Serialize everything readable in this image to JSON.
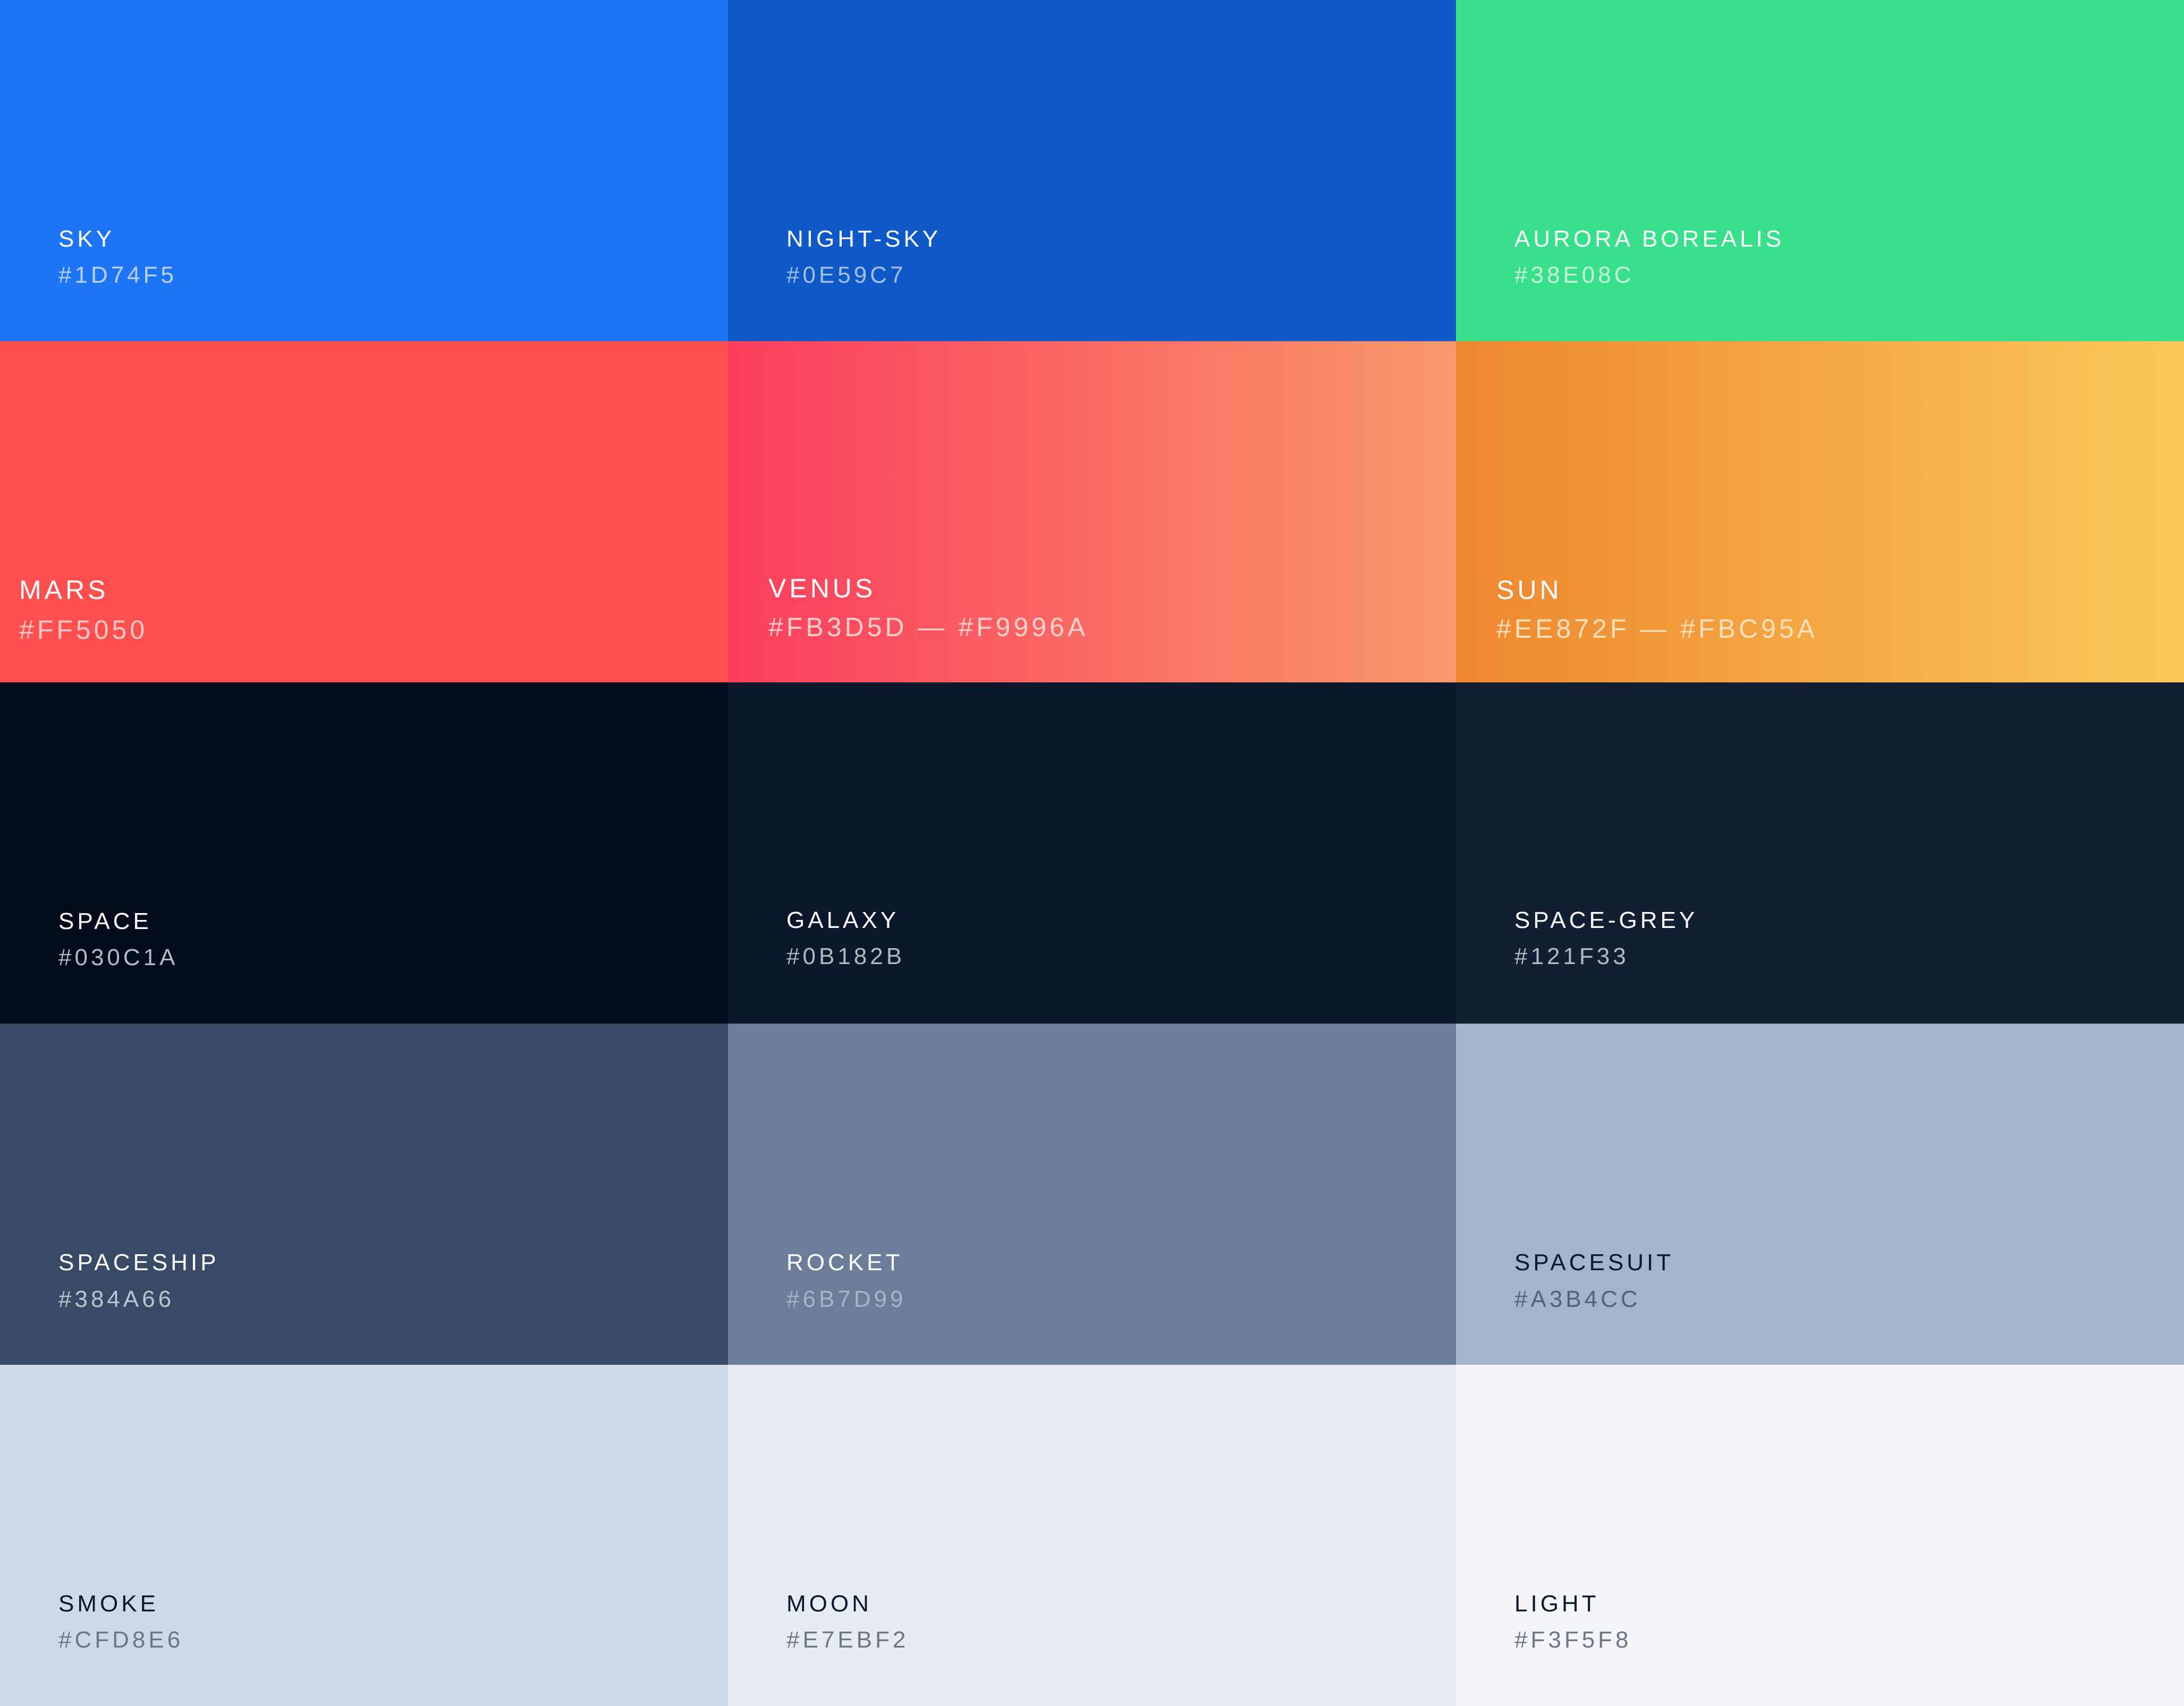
{
  "swatches": [
    {
      "id": "sky",
      "name": "SKY",
      "hex_label": "#1D74F5",
      "colors": [
        "#1D74F5"
      ],
      "name_color": "#ffffff",
      "hex_color": "#B9D2FB"
    },
    {
      "id": "night-sky",
      "name": "NIGHT-SKY",
      "hex_label": "#0E59C7",
      "colors": [
        "#0E59C7"
      ],
      "name_color": "#ffffff",
      "hex_color": "#A6BFE7"
    },
    {
      "id": "aurora-borealis",
      "name": "AURORA BOREALIS",
      "hex_label": "#38E08C",
      "colors": [
        "#38E08C"
      ],
      "name_color": "#ffffff",
      "hex_color": "#C6F5DC"
    },
    {
      "id": "mars",
      "name": "MARS",
      "hex_label": "#FF5050",
      "colors": [
        "#FF5050"
      ],
      "name_color": "#ffffff",
      "hex_color": "#FFC6C6"
    },
    {
      "id": "venus",
      "name": "VENUS",
      "hex_label": "#FB3D5D — #F9996A",
      "colors": [
        "#FB3D5D",
        "#F9996A"
      ],
      "name_color": "#ffffff",
      "hex_color": "#FFD0CC"
    },
    {
      "id": "sun",
      "name": "SUN",
      "hex_label": "#EE872F — #FBC95A",
      "colors": [
        "#EE872F",
        "#FBC95A"
      ],
      "name_color": "#ffffff",
      "hex_color": "#FDE0BC"
    },
    {
      "id": "space",
      "name": "SPACE",
      "hex_label": "#030C1A",
      "colors": [
        "#030C1A"
      ],
      "name_color": "#ffffff",
      "hex_color": "#B5BAC3"
    },
    {
      "id": "galaxy",
      "name": "GALAXY",
      "hex_label": "#0B182B",
      "colors": [
        "#0B182B"
      ],
      "name_color": "#ffffff",
      "hex_color": "#B1B8C2"
    },
    {
      "id": "space-grey",
      "name": "SPACE-GREY",
      "hex_label": "#121F33",
      "colors": [
        "#121F33"
      ],
      "name_color": "#ffffff",
      "hex_color": "#B3BAC4"
    },
    {
      "id": "spaceship",
      "name": "SPACESHIP",
      "hex_label": "#384A66",
      "colors": [
        "#384A66"
      ],
      "name_color": "#ffffff",
      "hex_color": "#BCC4D1"
    },
    {
      "id": "rocket",
      "name": "ROCKET",
      "hex_label": "#6B7D99",
      "colors": [
        "#6B7D99"
      ],
      "name_color": "#ffffff",
      "hex_color": "#A8B4C6"
    },
    {
      "id": "spacesuit",
      "name": "SPACESUIT",
      "hex_label": "#A3B4CC",
      "colors": [
        "#A3B4CC"
      ],
      "name_color": "#0B182B",
      "hex_color": "#56627A"
    },
    {
      "id": "smoke",
      "name": "SMOKE",
      "hex_label": "#CFD8E6",
      "colors": [
        "#CFD8E6"
      ],
      "name_color": "#0B182B",
      "hex_color": "#6B7688"
    },
    {
      "id": "moon",
      "name": "MOON",
      "hex_label": "#E7EBF2",
      "colors": [
        "#E7EBF2"
      ],
      "name_color": "#0B182B",
      "hex_color": "#6E7686"
    },
    {
      "id": "light",
      "name": "LIGHT",
      "hex_label": "#F3F5F8",
      "colors": [
        "#F3F5F8"
      ],
      "name_color": "#0B182B",
      "hex_color": "#6E7686"
    }
  ]
}
